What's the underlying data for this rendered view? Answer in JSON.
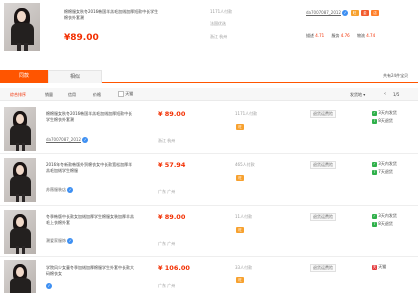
{
  "top_item": {
    "title": "棉棉服女秋冬2016韩国羊羔毛加绒加厚短款中长学生棉衣外套潮",
    "price": "¥89.00",
    "sales": "1171人付款",
    "shop": "法国优选",
    "location": "浙江 杭州",
    "seller_id": "da7007087_2012",
    "rating_labels": [
      "描述",
      "服务",
      "物流"
    ],
    "rating_values": [
      "4.71",
      "4.76",
      "4.74"
    ]
  },
  "tabs": {
    "same": "同款",
    "similar": "相似"
  },
  "result_count": "共有24件宝贝",
  "filters": {
    "all_label": "综合排序",
    "sales_label": "销量",
    "credit_label": "信用",
    "price_label": "价格",
    "tmall_label": "天猫",
    "shipping_label": "发货地",
    "page_label": "1/5"
  },
  "rows": [
    {
      "title": "棉棉服女秋冬2016韩国羊羔毛加绒加厚短款中长学生棉衣外套潮",
      "seller": "da7007087_2012",
      "price": "¥ 89.00",
      "location": "浙江 杭州",
      "sales": "1171人付款",
      "ship_tag": "退货运费险",
      "svc1": "3天内发货",
      "svc2": "8天退货"
    },
    {
      "title": "2016年冬新款韩版外贸棉衣女中长款宽松加厚羊羔毛加绒学生棉服",
      "seller": "苏薇服装店",
      "price": "¥ 57.94",
      "location": "广东 广州",
      "sales": "465人付款",
      "ship_tag": "退货运费险",
      "svc1": "3天内发货",
      "svc2": "7天退货"
    },
    {
      "title": "冬季韩版中长款女加绒加厚学生棉服女装加厚羊羔毛上衣棉外套",
      "seller": "潮爱家服饰",
      "price": "¥ 89.00",
      "location": "广东 广州",
      "sales": "11人付款",
      "ship_tag": "退货运费险",
      "svc1": "3天内发货",
      "svc2": "8天退货"
    },
    {
      "title": "学院风少女童冬季加绒加厚棉服学生外套中长款大码棉衣女",
      "seller": "",
      "price": "¥ 106.00",
      "location": "广东 广州",
      "sales": "33人付款",
      "ship_tag": "退货运费险",
      "svc1": "天猫",
      "svc2": ""
    }
  ],
  "colors": {
    "accent": "#f22e00",
    "tab_active": "#ff5500"
  }
}
